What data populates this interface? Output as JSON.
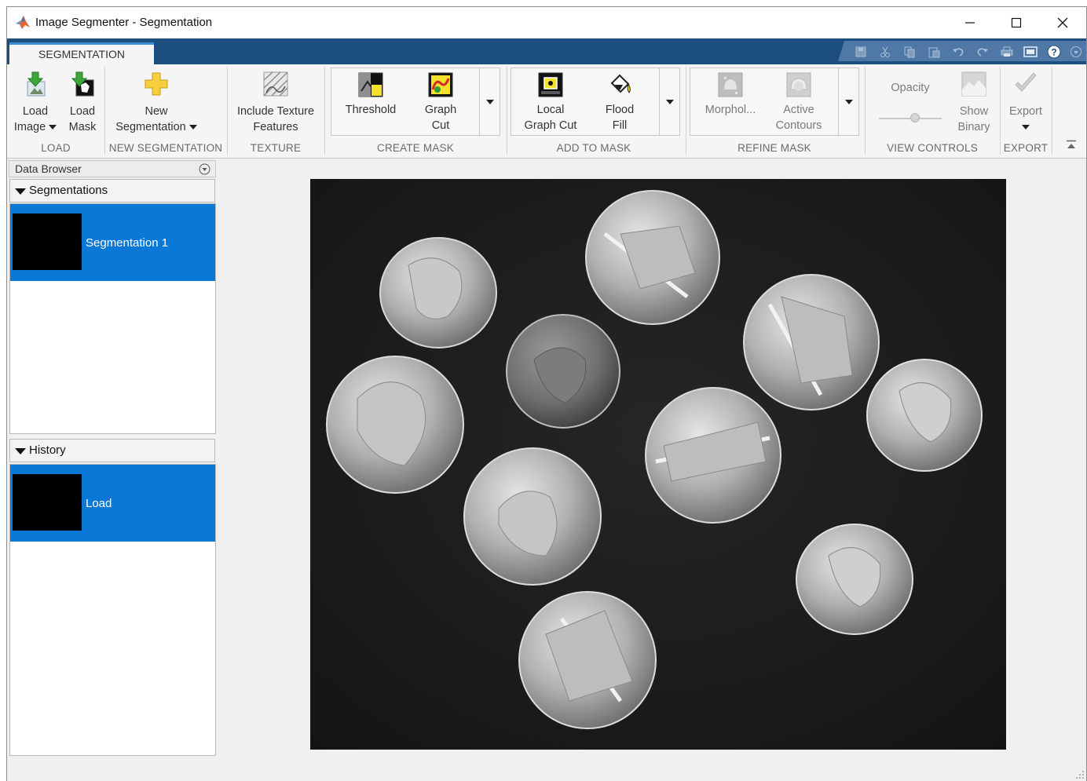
{
  "window": {
    "title": "Image Segmenter - Segmentation"
  },
  "tabs": [
    {
      "label": "SEGMENTATION",
      "active": true
    }
  ],
  "quick_access": [
    {
      "icon": "save-icon"
    },
    {
      "icon": "cut-icon"
    },
    {
      "icon": "copy-icon"
    },
    {
      "icon": "paste-icon"
    },
    {
      "icon": "undo-icon"
    },
    {
      "icon": "redo-icon"
    },
    {
      "icon": "print-icon"
    },
    {
      "icon": "window-layout-icon"
    },
    {
      "icon": "help-icon"
    },
    {
      "icon": "options-icon"
    }
  ],
  "ribbon": {
    "load": {
      "label": "LOAD",
      "load_image": {
        "line1": "Load",
        "line2": "Image"
      },
      "load_mask": {
        "line1": "Load",
        "line2": "Mask"
      }
    },
    "new_segmentation": {
      "label": "NEW SEGMENTATION",
      "button": {
        "line1": "New",
        "line2": "Segmentation"
      }
    },
    "texture": {
      "label": "TEXTURE",
      "button": {
        "line1": "Include Texture",
        "line2": "Features"
      }
    },
    "create_mask": {
      "label": "CREATE MASK",
      "threshold": {
        "line1": "Threshold"
      },
      "graph_cut": {
        "line1": "Graph",
        "line2": "Cut"
      }
    },
    "add_to_mask": {
      "label": "ADD TO MASK",
      "local_graph_cut": {
        "line1": "Local",
        "line2": "Graph Cut"
      },
      "flood_fill": {
        "line1": "Flood",
        "line2": "Fill"
      }
    },
    "refine_mask": {
      "label": "REFINE MASK",
      "morphology": {
        "line1": "Morphol..."
      },
      "active_contours": {
        "line1": "Active",
        "line2": "Contours"
      }
    },
    "view_controls": {
      "label": "VIEW CONTROLS",
      "opacity": {
        "label": "Opacity"
      },
      "show_binary": {
        "line1": "Show",
        "line2": "Binary"
      }
    },
    "export": {
      "label": "EXPORT",
      "button": {
        "line1": "Export"
      }
    }
  },
  "left_panel": {
    "data_browser": {
      "title": "Data Browser"
    },
    "segmentations": {
      "title": "Segmentations",
      "items": [
        {
          "label": "Segmentation 1",
          "selected": true
        }
      ]
    },
    "history": {
      "title": "History",
      "items": [
        {
          "label": "Load",
          "selected": true
        }
      ]
    }
  },
  "colors": {
    "tab_strip": "#1c4e80",
    "selection": "#0a78d7",
    "ribbon_bg": "#f5f5f5",
    "image_bg": "#1c1c1c"
  }
}
